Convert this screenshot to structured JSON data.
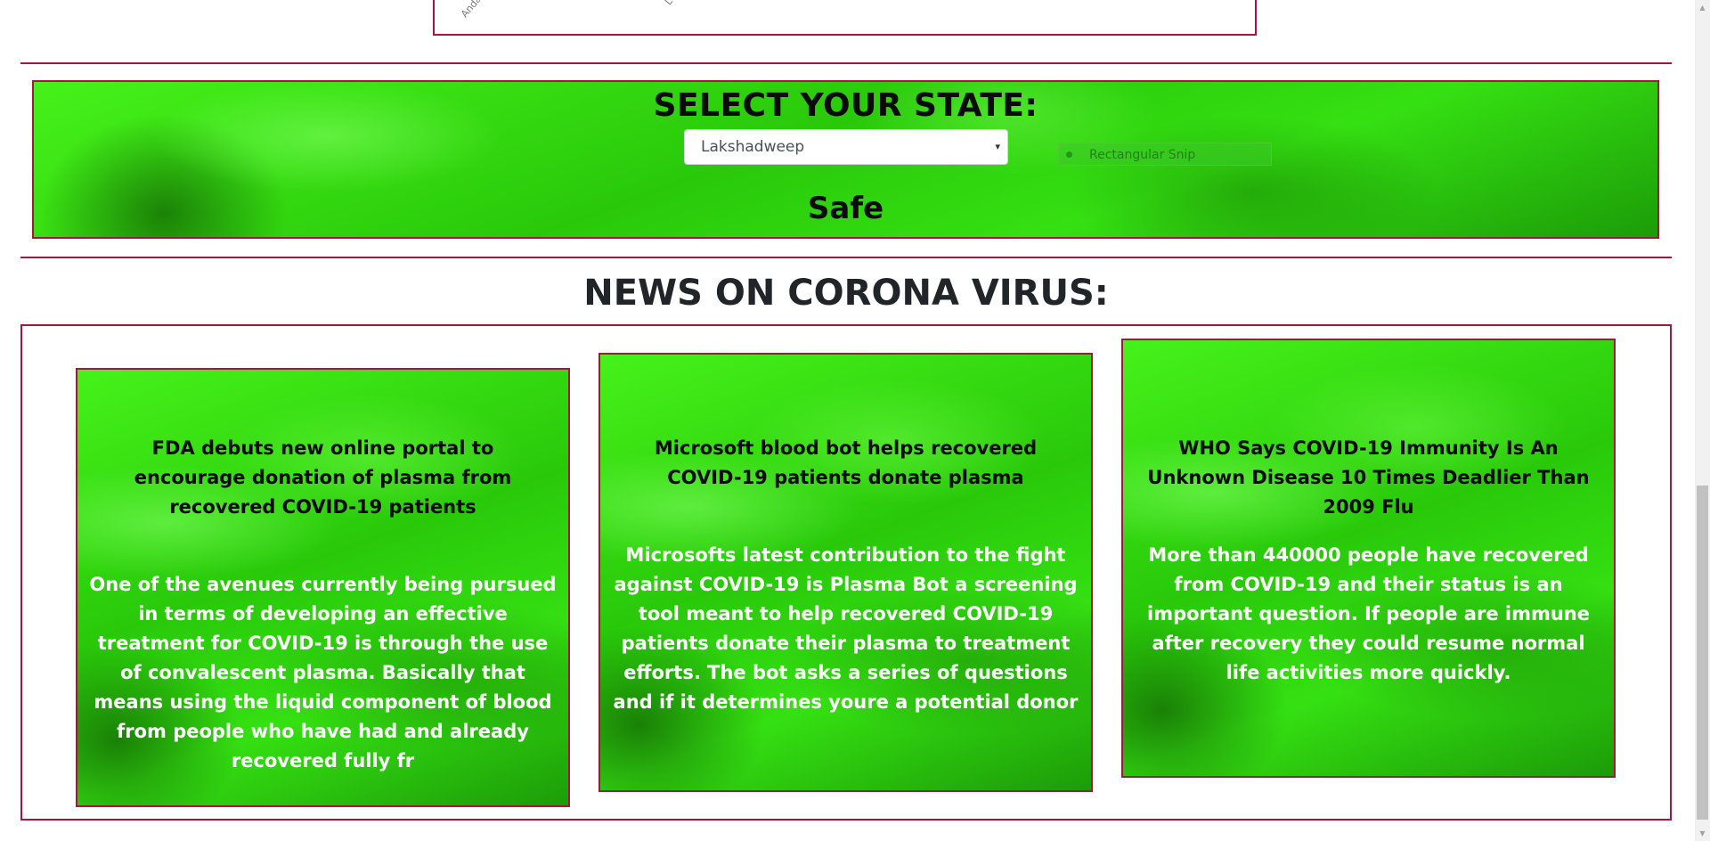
{
  "map": {
    "label_a": "Andam",
    "label_b": "L"
  },
  "state_selector": {
    "title": "SELECT YOUR STATE:",
    "selected_state": "Lakshadweep",
    "status": "Safe",
    "snip_overlay": "Rectangular Snip"
  },
  "news": {
    "heading": "NEWS ON CORONA VIRUS:",
    "cards": [
      {
        "title": "FDA debuts new online portal to encourage donation of plasma from recovered COVID-19 patients",
        "body": "One of the avenues currently being pursued in terms of developing an effective treatment for COVID-19 is through the use of convalescent plasma. Basically that means using the liquid component of blood from people who have had and already recovered fully fr"
      },
      {
        "title": "Microsoft blood bot helps recovered COVID-19 patients donate plasma",
        "body": "Microsofts latest contribution to the fight against COVID-19 is Plasma Bot a screening tool meant to help recovered COVID-19 patients donate their plasma to treatment efforts. The bot asks a series of questions and if it determines youre a potential donor"
      },
      {
        "title": "WHO Says COVID-19 Immunity Is An Unknown Disease 10 Times Deadlier Than 2009 Flu",
        "body": "More than 440000 people have recovered from COVID-19 and their status is an important question. If people are immune after recovery they could resume normal life activities more quickly."
      }
    ]
  },
  "icons": {
    "select_arrow": "▾",
    "scroll_up": "▲",
    "scroll_down": "▼"
  },
  "colors": {
    "accent_border": "#a3163d",
    "panel_green": "#2ed60a"
  }
}
